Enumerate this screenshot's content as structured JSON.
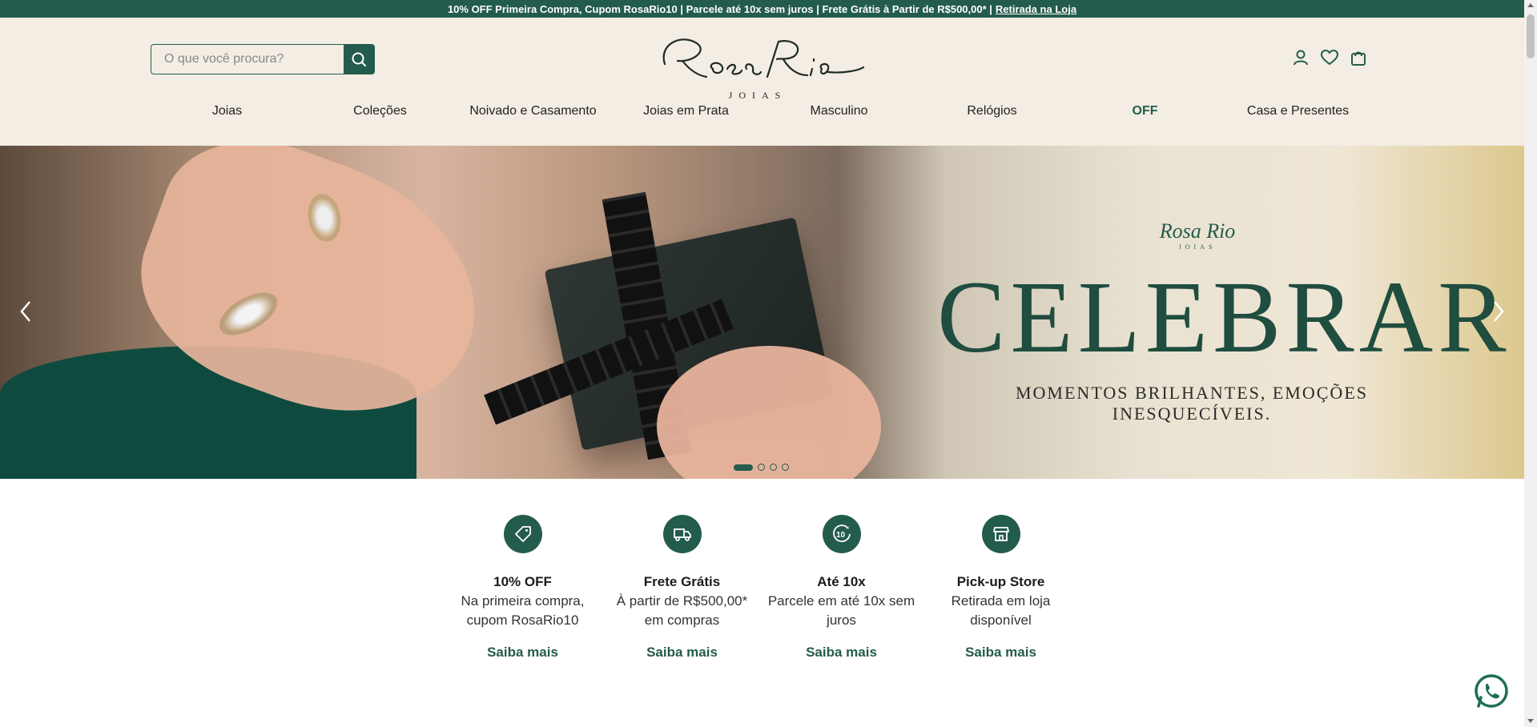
{
  "topbar": {
    "promo_text": "10% OFF Primeira Compra, Cupom RosaRio10 | Parcele até 10x sem juros | Frete Grátis à Partir de R$500,00* |",
    "pickup_link": "Retirada na Loja"
  },
  "header": {
    "search_placeholder": "O que você procura?",
    "logo_text": "Rosa Rio",
    "logo_sub": "JOIAS",
    "icons": [
      "user-icon",
      "heart-icon",
      "cart-icon"
    ]
  },
  "nav": {
    "items": [
      {
        "label": "Joias"
      },
      {
        "label": "Coleções"
      },
      {
        "label": "Noivado e Casamento"
      },
      {
        "label": "Joias em Prata"
      },
      {
        "label": "Masculino"
      },
      {
        "label": "Relógios"
      },
      {
        "label": "OFF"
      },
      {
        "label": "Casa e Presentes"
      }
    ]
  },
  "hero": {
    "brand": "Rosa Rio",
    "brand_sub": "JOIAS",
    "title": "CELEBRAR",
    "subtitle": "MOMENTOS BRILHANTES, EMOÇÕES INESQUECÍVEIS.",
    "slides_count": 4,
    "active_slide": 1
  },
  "benefits": [
    {
      "icon": "tag-icon",
      "title": "10% OFF",
      "text": "Na primeira compra, cupom RosaRio10",
      "link": "Saiba mais"
    },
    {
      "icon": "truck-icon",
      "title": "Frete Grátis",
      "text": "À partir de R$500,00* em compras",
      "link": "Saiba mais"
    },
    {
      "icon": "installments-icon",
      "title": "Até 10x",
      "text": "Parcele em até 10x sem juros",
      "link": "Saiba mais"
    },
    {
      "icon": "store-icon",
      "title": "Pick-up Store",
      "text": "Retirada em loja disponível",
      "link": "Saiba mais"
    }
  ],
  "colors": {
    "brand_green": "#235c4c",
    "header_bg": "#f3ede3"
  }
}
